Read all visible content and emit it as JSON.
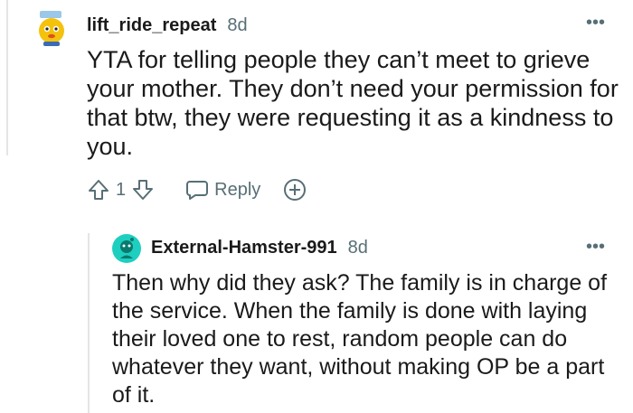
{
  "comments": [
    {
      "username": "lift_ride_repeat",
      "age": "8d",
      "body": "YTA for telling people they can’t meet to grieve your mother. They don’t need your permission for that btw, they were requesting it as a kindness to you.",
      "score": "1",
      "reply_label": "Reply",
      "more_label": "•••",
      "avatar_icon": "snoo-avatar-icon"
    },
    {
      "username": "External-Hamster-991",
      "age": "8d",
      "body": "Then why did they ask? The family is in charge of the service. When the family is done with laying their loved one to rest, random people can do whatever they want, without making OP be a part of it.",
      "more_label": "•••",
      "avatar_icon": "snoo-avatar-icon",
      "avatar_color": "#1ecfc0"
    }
  ]
}
